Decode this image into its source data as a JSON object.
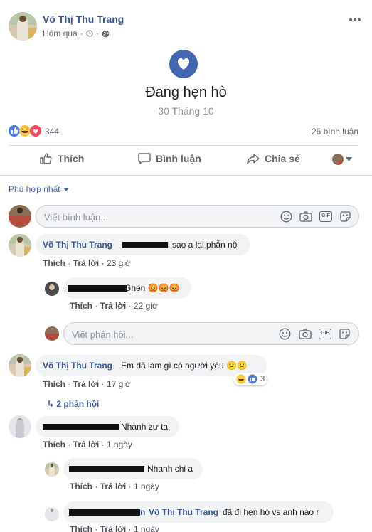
{
  "post": {
    "author": "Võ Thị Thu Trang",
    "time": "Hôm qua",
    "time_separator": "·",
    "more_icon": "more-dots-icon",
    "event_title": "Đang hẹn hò",
    "event_date": "30 Tháng 10",
    "event_icon": "heart-icon",
    "accent_color": "#4267b2"
  },
  "reactions": {
    "count": "344",
    "comments_count": "26 bình luận",
    "icons": [
      "like-icon",
      "haha-icon",
      "love-icon"
    ]
  },
  "actions": {
    "like": "Thích",
    "comment": "Bình luận",
    "share": "Chia sẻ"
  },
  "sort": {
    "label": "Phù hợp nhất"
  },
  "composer": {
    "placeholder": "Viết bình luận...",
    "reply_placeholder": "Viết phản hồi...",
    "tools": [
      "emoji-icon",
      "camera-icon",
      "gif-icon",
      "sticker-icon"
    ],
    "gif_label": "GIF"
  },
  "comments": [
    {
      "author": "Võ Thị Thu Trang",
      "text": "i sao a lại phẫn nộ",
      "like": "Thích",
      "reply": "Trả lời",
      "time": "23 giờ",
      "replies": [
        {
          "text": "Ghen 😡😡😡",
          "like": "Thích",
          "reply": "Trả lời",
          "time": "22 giờ"
        }
      ]
    },
    {
      "author": "Võ Thị Thu Trang",
      "text": "Em đã làm gì có người yêu 😕😕",
      "like": "Thích",
      "reply": "Trả lời",
      "time": "17 giờ",
      "reaction_count": "3",
      "replies_link": "↳ 2 phản hồi"
    },
    {
      "text": "Nhanh zư ta",
      "like": "Thích",
      "reply": "Trả lời",
      "time": "1 ngày",
      "replies": [
        {
          "text": "Nhanh chi a",
          "like": "Thích",
          "reply": "Trả lời",
          "time": "1 ngày"
        },
        {
          "author_suffix": "n",
          "mention": "Võ Thị Thu Trang",
          "text": "đã đi hẹn hò vs anh nào r",
          "like": "Thích",
          "reply": "Trả lời",
          "time": "1 ngày"
        }
      ]
    }
  ]
}
